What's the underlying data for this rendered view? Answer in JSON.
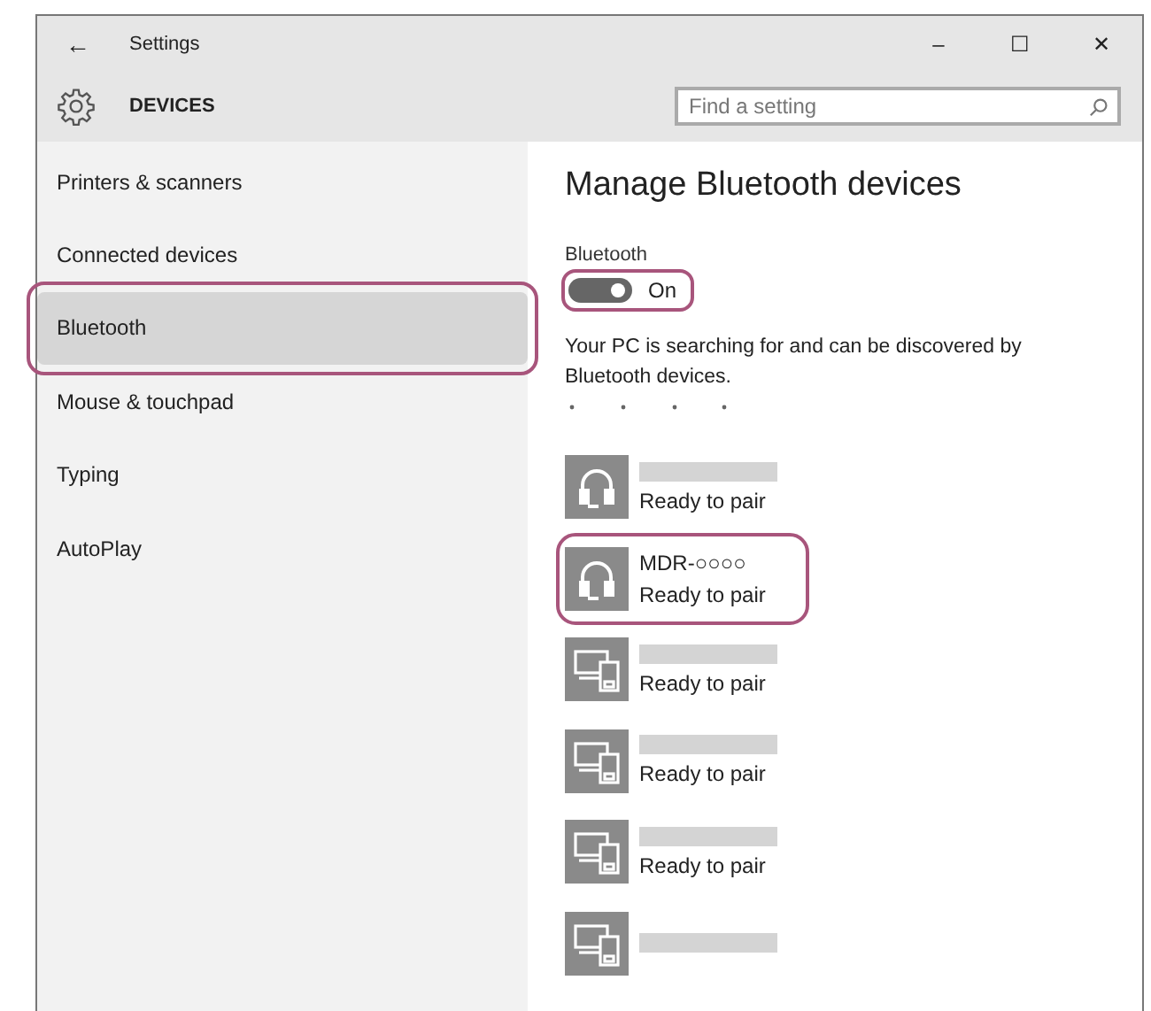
{
  "window": {
    "title": "Settings",
    "back_icon": "←",
    "controls": [
      "–",
      "☐",
      "✕"
    ]
  },
  "header": {
    "title": "DEVICES",
    "search": {
      "placeholder": "Find a setting"
    }
  },
  "sidebar": {
    "items": [
      {
        "label": "Printers & scanners",
        "selected": false,
        "highlighted": false
      },
      {
        "label": "Connected devices",
        "selected": false,
        "highlighted": false
      },
      {
        "label": "Bluetooth",
        "selected": true,
        "highlighted": true
      },
      {
        "label": "Mouse & touchpad",
        "selected": false,
        "highlighted": false
      },
      {
        "label": "Typing",
        "selected": false,
        "highlighted": false
      },
      {
        "label": "AutoPlay",
        "selected": false,
        "highlighted": false
      }
    ]
  },
  "content": {
    "heading": "Manage Bluetooth devices",
    "bluetooth_toggle": {
      "label": "Bluetooth",
      "on": true,
      "state_text": "On",
      "highlighted": true
    },
    "description": "Your PC is searching for and can be discovered by Bluetooth devices.",
    "devices": [
      {
        "kind": "headphones",
        "status": "Ready to pair",
        "highlighted": false
      },
      {
        "kind": "headphones",
        "name": "MDR-○○○○",
        "status": "Ready to pair",
        "highlighted": true
      },
      {
        "kind": "computer",
        "status": "Ready to pair",
        "highlighted": false
      },
      {
        "kind": "computer",
        "status": "Ready to pair",
        "highlighted": false
      },
      {
        "kind": "computer",
        "status": "Ready to pair",
        "highlighted": false
      },
      {
        "kind": "computer",
        "highlighted": false
      }
    ]
  }
}
